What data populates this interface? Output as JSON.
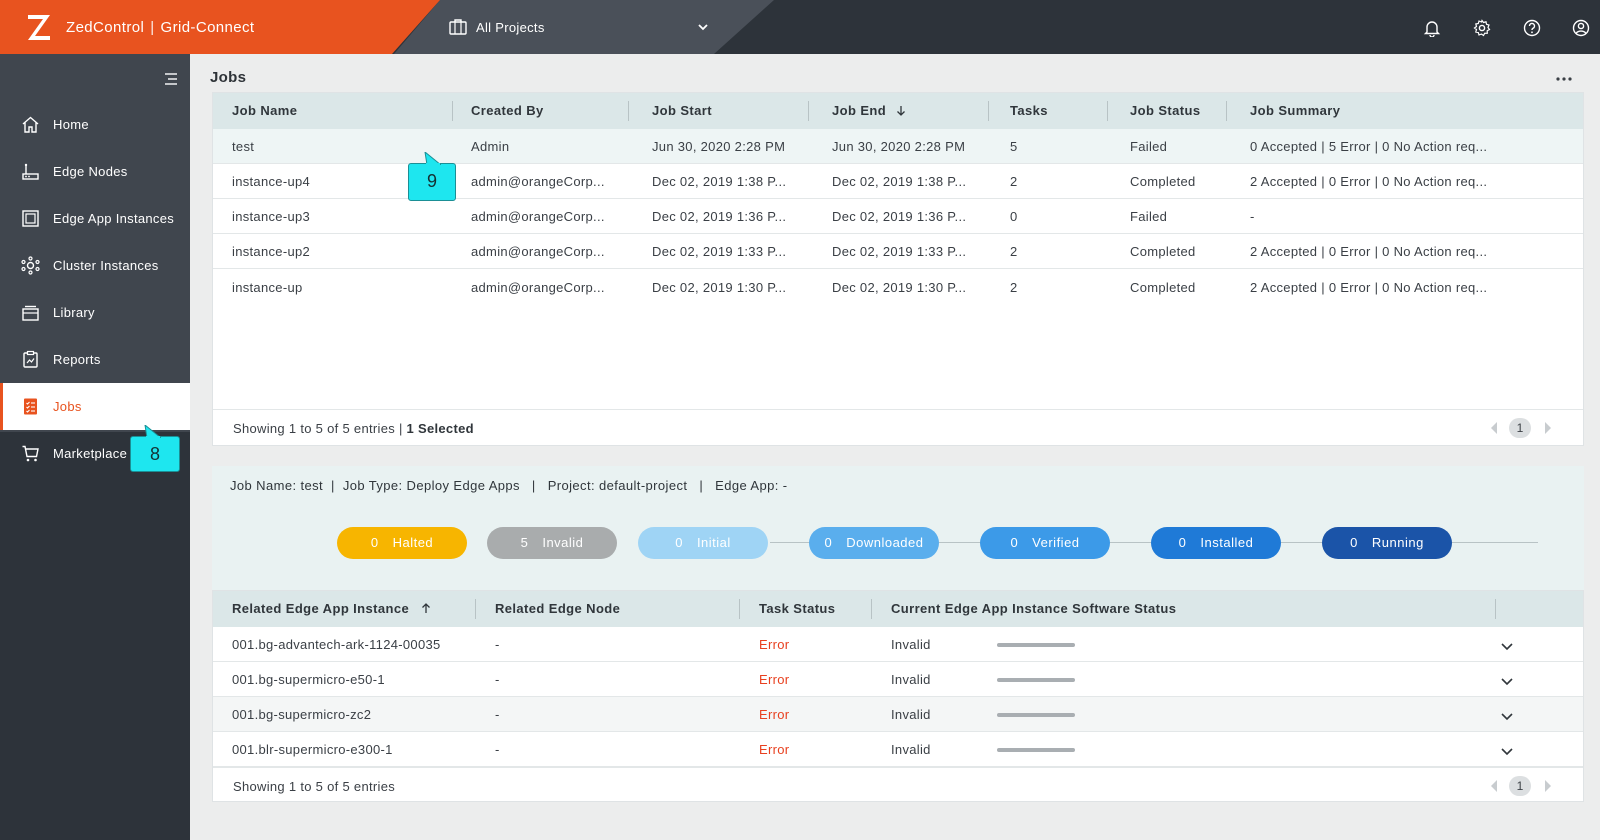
{
  "header": {
    "brand_product": "ZedControl",
    "brand_org": "Grid-Connect",
    "brand_separator": "|",
    "project_selector": "All Projects",
    "icons": [
      "bell-icon",
      "gear-icon",
      "help-icon",
      "user-icon"
    ]
  },
  "sidebar": {
    "items": [
      {
        "label": "Home",
        "icon": "home-icon"
      },
      {
        "label": "Edge Nodes",
        "icon": "edge-node-icon"
      },
      {
        "label": "Edge App Instances",
        "icon": "app-instances-icon"
      },
      {
        "label": "Cluster Instances",
        "icon": "cluster-icon"
      },
      {
        "label": "Library",
        "icon": "library-icon"
      },
      {
        "label": "Reports",
        "icon": "reports-icon"
      },
      {
        "label": "Jobs",
        "icon": "jobs-icon",
        "active": true
      },
      {
        "label": "Marketplace",
        "icon": "cart-icon"
      }
    ]
  },
  "callouts": {
    "sidebar": "8",
    "table": "9"
  },
  "colors": {
    "brand": "#e8531f",
    "halted": "#f7b500",
    "invalid": "#a9acad",
    "initial": "#9fd4f5",
    "downloaded": "#5aaeed",
    "verified": "#3c9ae8",
    "installed": "#1f7ad7",
    "running": "#1b54a8",
    "error": "#e8401f",
    "callout": "#1ee6ef"
  },
  "jobs": {
    "title": "Jobs",
    "columns": [
      "Job Name",
      "Created By",
      "Job Start",
      "Job End",
      "Tasks",
      "Job Status",
      "Job Summary"
    ],
    "rows": [
      [
        "test",
        "Admin",
        "Jun 30, 2020  2:28 PM",
        "Jun 30, 2020  2:28 PM",
        "5",
        "Failed",
        "0 Accepted | 5 Error | 0 No Action req..."
      ],
      [
        "instance-up4",
        "admin@orangeCorp...",
        "Dec 02, 2019  1:38 P...",
        "Dec 02, 2019  1:38 P...",
        "2",
        "Completed",
        "2 Accepted | 0 Error | 0 No Action req..."
      ],
      [
        "instance-up3",
        "admin@orangeCorp...",
        "Dec 02, 2019  1:36 P...",
        "Dec 02, 2019  1:36 P...",
        "0",
        "Failed",
        "-"
      ],
      [
        "instance-up2",
        "admin@orangeCorp...",
        "Dec 02, 2019  1:33 P...",
        "Dec 02, 2019  1:33 P...",
        "2",
        "Completed",
        "2 Accepted | 0 Error | 0 No Action req..."
      ],
      [
        "instance-up",
        "admin@orangeCorp...",
        "Dec 02, 2019  1:30 P...",
        "Dec 02, 2019  1:30 P...",
        "2",
        "Completed",
        "2 Accepted | 0 Error | 0 No Action req..."
      ]
    ],
    "footer_info": "Showing 1 to 5 of 5 entries |",
    "footer_selected": "1 Selected",
    "page": "1"
  },
  "detail": {
    "job_name": "Job Name: test",
    "job_type": "Job Type: Deploy Edge Apps",
    "project": "Project: default-project",
    "edge_app": "Edge App: -",
    "pills": [
      {
        "count": "0",
        "label": "Halted"
      },
      {
        "count": "5",
        "label": "Invalid"
      },
      {
        "count": "0",
        "label": "Initial"
      },
      {
        "count": "0",
        "label": "Downloaded"
      },
      {
        "count": "0",
        "label": "Verified"
      },
      {
        "count": "0",
        "label": "Installed"
      },
      {
        "count": "0",
        "label": "Running"
      }
    ]
  },
  "tasks": {
    "columns": [
      "Related Edge App Instance",
      "Related Edge Node",
      "Task Status",
      "Current Edge App Instance Software Status"
    ],
    "rows": [
      [
        "001.bg-advantech-ark-1124-00035",
        "-",
        "Error",
        "Invalid"
      ],
      [
        "001.bg-supermicro-e50-1",
        "-",
        "Error",
        "Invalid"
      ],
      [
        "001.bg-supermicro-zc2",
        "-",
        "Error",
        "Invalid"
      ],
      [
        "001.blr-supermicro-e300-1",
        "-",
        "Error",
        "Invalid"
      ]
    ],
    "footer_info": "Showing 1 to 5 of 5 entries",
    "page": "1"
  }
}
